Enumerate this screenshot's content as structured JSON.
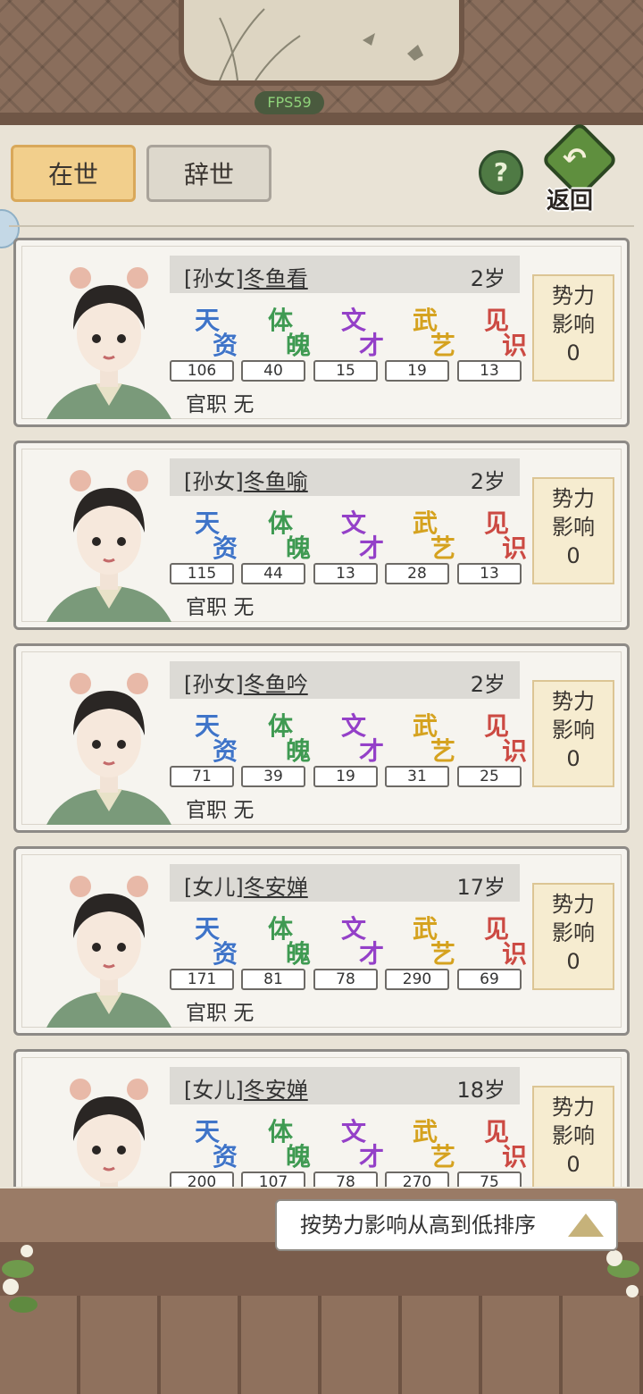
{
  "header": {
    "fps": "FPS59",
    "tabs": [
      {
        "label": "在世",
        "active": true
      },
      {
        "label": "辞世",
        "active": false
      }
    ],
    "help_icon": "?",
    "back_label": "返回"
  },
  "stat_labels": [
    {
      "top": "天",
      "bottom": "资"
    },
    {
      "top": "体",
      "bottom": "魄"
    },
    {
      "top": "文",
      "bottom": "才"
    },
    {
      "top": "武",
      "bottom": "艺"
    },
    {
      "top": "见",
      "bottom": "识"
    }
  ],
  "influence_label": [
    "势力",
    "影响"
  ],
  "office_label": "官职",
  "members": [
    {
      "relation": "[孙女]",
      "name": "冬鱼看",
      "age": "2岁",
      "stats": [
        "106",
        "40",
        "15",
        "19",
        "13"
      ],
      "office": "无",
      "influence": "0"
    },
    {
      "relation": "[孙女]",
      "name": "冬鱼喻",
      "age": "2岁",
      "stats": [
        "115",
        "44",
        "13",
        "28",
        "13"
      ],
      "office": "无",
      "influence": "0"
    },
    {
      "relation": "[孙女]",
      "name": "冬鱼吟",
      "age": "2岁",
      "stats": [
        "71",
        "39",
        "19",
        "31",
        "25"
      ],
      "office": "无",
      "influence": "0"
    },
    {
      "relation": "[女儿]",
      "name": "冬安婵",
      "age": "17岁",
      "stats": [
        "171",
        "81",
        "78",
        "290",
        "69"
      ],
      "office": "无",
      "influence": "0"
    },
    {
      "relation": "[女儿]",
      "name": "冬安婵",
      "age": "18岁",
      "stats": [
        "200",
        "107",
        "78",
        "270",
        "75"
      ],
      "office": "",
      "influence": "0"
    }
  ],
  "sort_button": "按势力影响从高到低排序",
  "colors": {
    "tian": "#3f74c8",
    "ti": "#3f9a52",
    "wen": "#9440c8",
    "wu": "#d5a21f",
    "jian": "#cc4a43",
    "active_tab": "#f2cf8c",
    "influence_bg": "#f6ecd0"
  }
}
